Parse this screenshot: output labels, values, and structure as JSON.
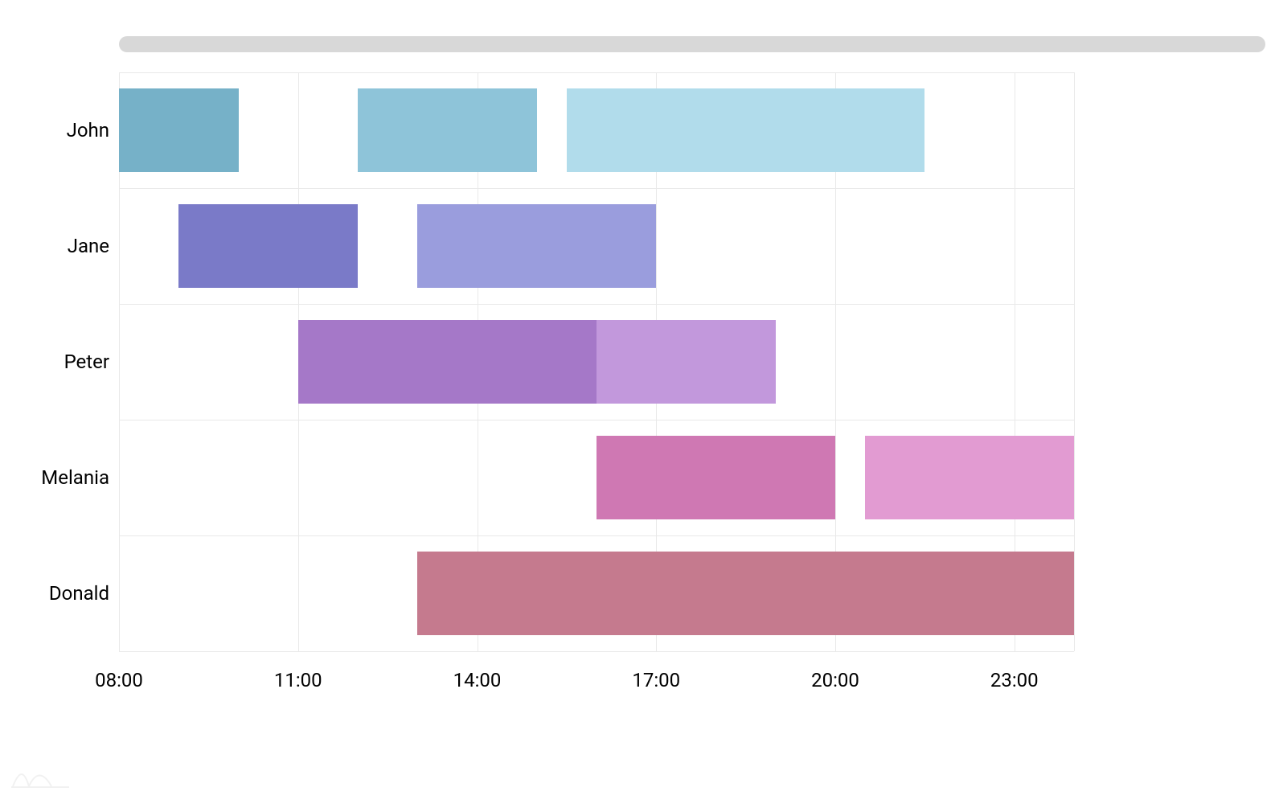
{
  "chart_data": {
    "type": "gantt",
    "x_axis_type": "time",
    "x_range": [
      "08:00",
      "24:00"
    ],
    "x_ticks": [
      "08:00",
      "11:00",
      "14:00",
      "17:00",
      "20:00",
      "23:00"
    ],
    "categories": [
      "John",
      "Jane",
      "Peter",
      "Melania",
      "Donald"
    ],
    "series": [
      {
        "category": "John",
        "start": "08:00",
        "end": "10:00",
        "color": "#76b1c8"
      },
      {
        "category": "John",
        "start": "12:00",
        "end": "15:00",
        "color": "#8ec4d9"
      },
      {
        "category": "John",
        "start": "15:30",
        "end": "21:30",
        "color": "#b1dceb"
      },
      {
        "category": "Jane",
        "start": "09:00",
        "end": "12:00",
        "color": "#7a7ac8"
      },
      {
        "category": "Jane",
        "start": "13:00",
        "end": "17:00",
        "color": "#9a9ddd"
      },
      {
        "category": "Peter",
        "start": "11:00",
        "end": "16:00",
        "color": "#a578c8"
      },
      {
        "category": "Peter",
        "start": "16:00",
        "end": "19:00",
        "color": "#c298dc"
      },
      {
        "category": "Melania",
        "start": "16:00",
        "end": "20:00",
        "color": "#cf78b3"
      },
      {
        "category": "Melania",
        "start": "20:30",
        "end": "24:00",
        "color": "#e29bd2"
      },
      {
        "category": "Donald",
        "start": "13:00",
        "end": "24:00",
        "color": "#c57a8e"
      }
    ]
  },
  "ui": {
    "ylabels": [
      "John",
      "Jane",
      "Peter",
      "Melania",
      "Donald"
    ],
    "xlabels": [
      "08:00",
      "11:00",
      "14:00",
      "17:00",
      "20:00",
      "23:00"
    ]
  }
}
